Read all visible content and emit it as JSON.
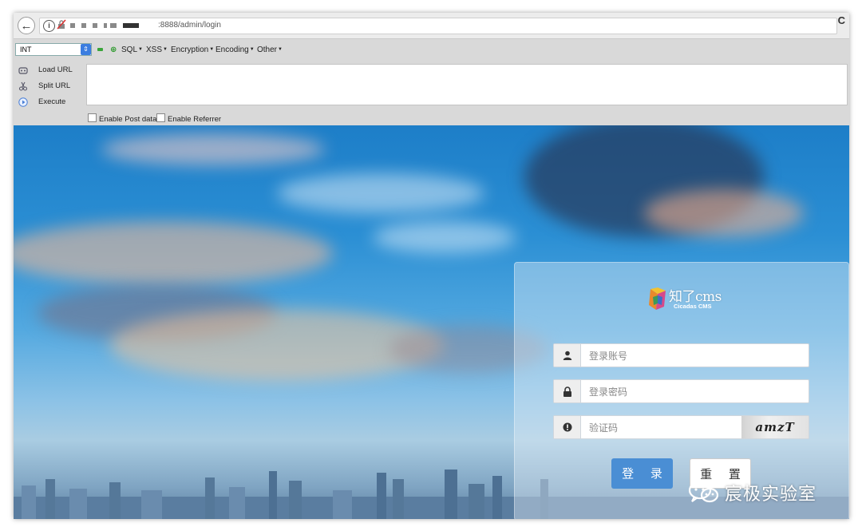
{
  "browser": {
    "url": ":8888/admin/login",
    "back_glyph": "←",
    "info_glyph": "i",
    "reload_glyph": "C"
  },
  "hackbar": {
    "select_value": "INT",
    "menus": [
      "SQL",
      "XSS",
      "Encryption",
      "Encoding",
      "Other"
    ],
    "actions": [
      "Load URL",
      "Split URL",
      "Execute"
    ],
    "checkboxes": [
      "Enable Post data",
      "Enable Referrer"
    ]
  },
  "login": {
    "logo_text": "知了cms",
    "logo_subtitle": "Cicadas CMS",
    "username_placeholder": "登录账号",
    "password_placeholder": "登录密码",
    "captcha_placeholder": "验证码",
    "captcha_text": "amzT",
    "login_button": "登 录",
    "reset_button": "重 置"
  },
  "watermark": {
    "text": "宸极实验室"
  },
  "colors": {
    "login_button": "#4a8ed4",
    "select_arrow": "#3b7de0"
  }
}
